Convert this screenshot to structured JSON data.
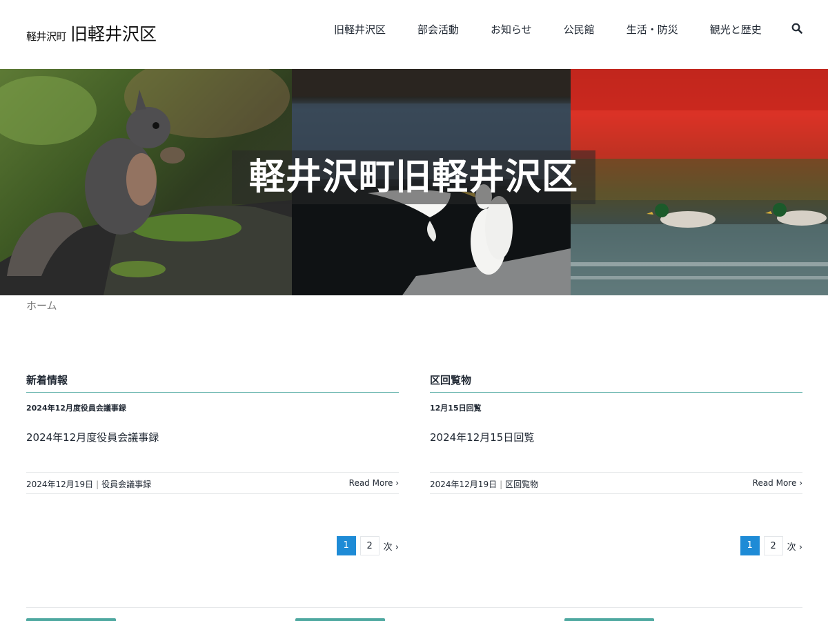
{
  "header": {
    "logo_small": "軽井沢町",
    "logo_large": "旧軽井沢区",
    "nav": [
      "旧軽井沢区",
      "部会活動",
      "お知らせ",
      "公民館",
      "生活・防災",
      "観光と歴史"
    ],
    "search_icon": "search-icon"
  },
  "hero": {
    "title": "軽井沢町旧軽井沢区"
  },
  "breadcrumb": "ホーム",
  "news": {
    "title": "新着情報",
    "tag": "2024年12月度役員会議事録",
    "post_title": "2024年12月度役員会議事録",
    "date": "2024年12月19日",
    "category": "役員会議事録",
    "read_more": "Read More",
    "pages": [
      "1",
      "2"
    ],
    "next": "次"
  },
  "circular": {
    "title": "区回覧物",
    "tag": "12月15日回覧",
    "post_title": "2024年12月15日回覧",
    "date": "2024年12月19日",
    "category": "区回覧物",
    "read_more": "Read More",
    "pages": [
      "1",
      "2"
    ],
    "next": "次"
  },
  "colors": {
    "accent": "#4ea8a0",
    "pager_active": "#1e8bd6"
  }
}
